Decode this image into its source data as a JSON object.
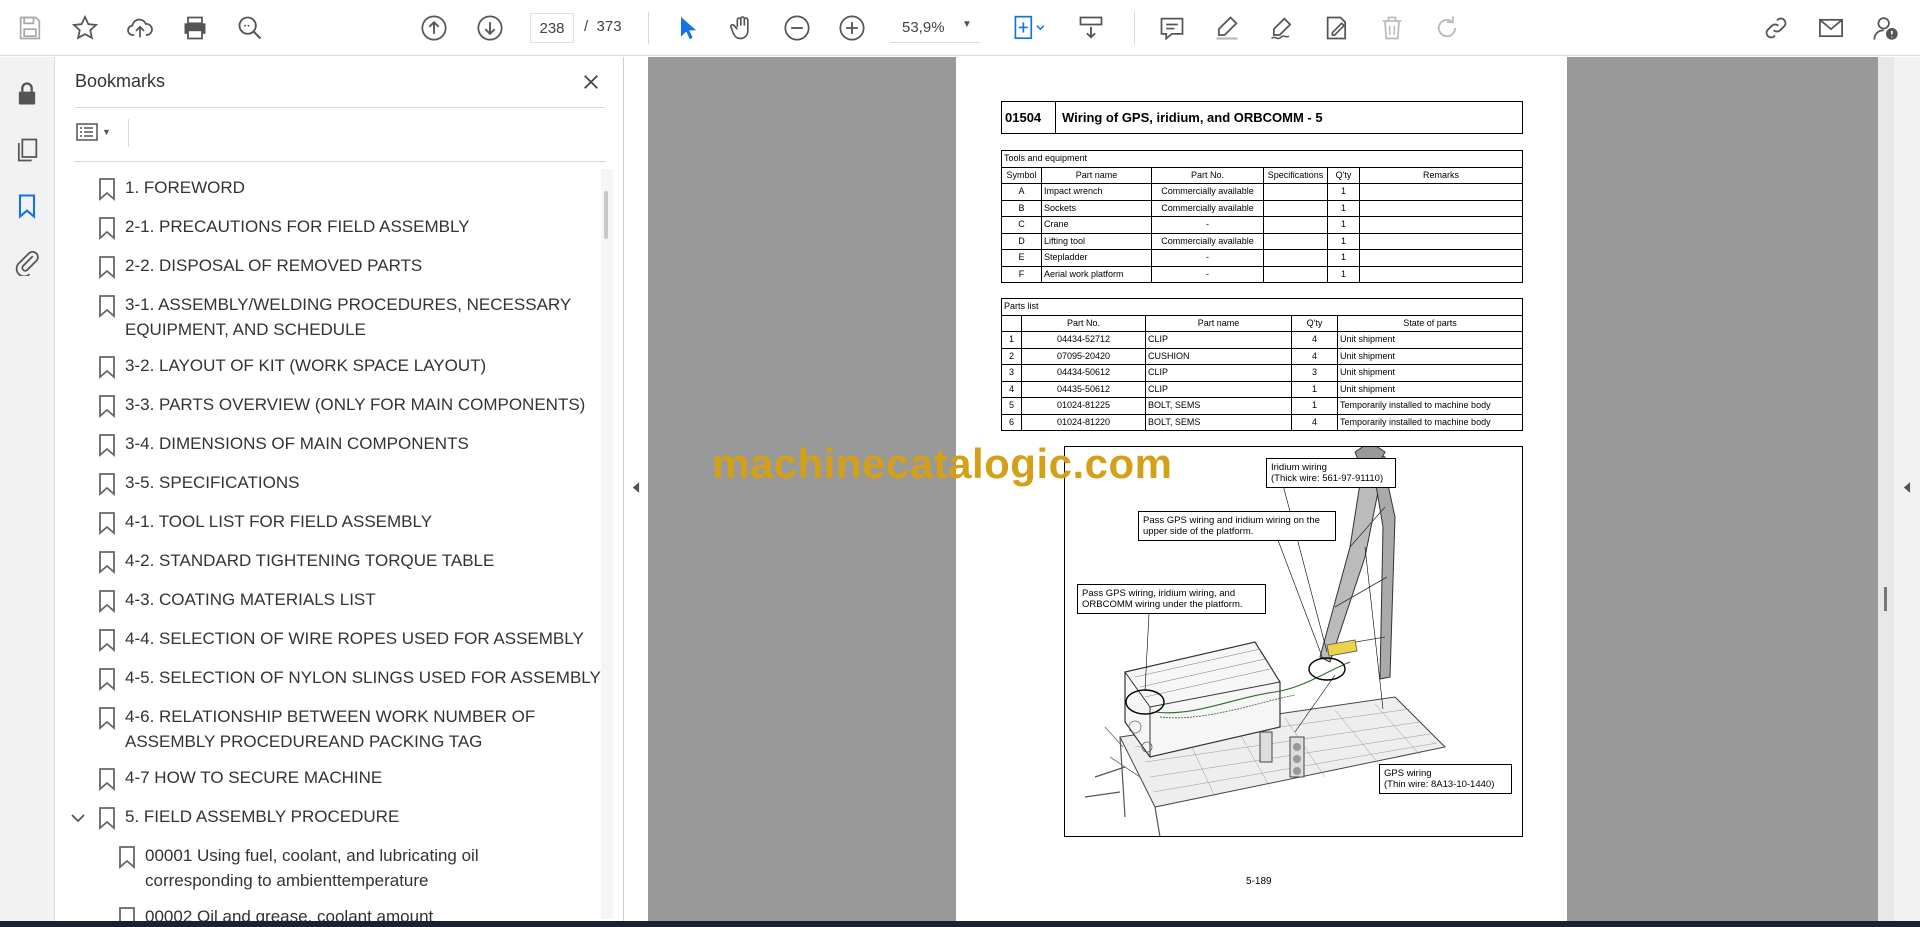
{
  "toolbar": {
    "page_current": "238",
    "page_total": "373",
    "page_separator": "/",
    "zoom": "53,9%"
  },
  "bookmarks": {
    "title": "Bookmarks",
    "items": [
      {
        "label": "1. FOREWORD"
      },
      {
        "label": "2-1. PRECAUTIONS FOR FIELD ASSEMBLY"
      },
      {
        "label": "2-2. DISPOSAL OF REMOVED PARTS"
      },
      {
        "label": "3-1. ASSEMBLY/WELDING PROCEDURES, NECESSARY",
        "label2": "EQUIPMENT, AND SCHEDULE"
      },
      {
        "label": "3-2. LAYOUT OF KIT (WORK SPACE LAYOUT)"
      },
      {
        "label": "3-3. PARTS OVERVIEW (ONLY FOR MAIN COMPONENTS)"
      },
      {
        "label": "3-4. DIMENSIONS OF MAIN COMPONENTS"
      },
      {
        "label": "3-5. SPECIFICATIONS"
      },
      {
        "label": "4-1. TOOL LIST FOR FIELD ASSEMBLY"
      },
      {
        "label": "4-2. STANDARD TIGHTENING TORQUE TABLE"
      },
      {
        "label": "4-3. COATING MATERIALS LIST"
      },
      {
        "label": "4-4. SELECTION OF WIRE ROPES USED FOR ASSEMBLY"
      },
      {
        "label": "4-5. SELECTION OF NYLON SLINGS USED FOR ASSEMBLY"
      },
      {
        "label": "4-6. RELATIONSHIP BETWEEN WORK NUMBER OF",
        "label2": "ASSEMBLY PROCEDUREAND PACKING TAG"
      },
      {
        "label": "4-7 HOW TO SECURE MACHINE"
      },
      {
        "label": "5. FIELD ASSEMBLY PROCEDURE"
      },
      {
        "label": "00001 Using fuel, coolant, and lubricating oil",
        "label2": "corresponding to ambienttemperature"
      },
      {
        "label": "00002 Oil and grease, coolant amount"
      }
    ]
  },
  "page": {
    "code": "01504",
    "title": "Wiring of GPS, iridium, and ORBCOMM - 5",
    "tools": {
      "caption": "Tools and equipment",
      "headers": [
        "Symbol",
        "Part name",
        "Part No.",
        "Specifications",
        "Q'ty",
        "Remarks"
      ],
      "rows": [
        [
          "A",
          "Impact wrench",
          "Commercially available",
          "",
          "1",
          ""
        ],
        [
          "B",
          "Sockets",
          "Commercially available",
          "",
          "1",
          ""
        ],
        [
          "C",
          "Crane",
          "-",
          "",
          "1",
          ""
        ],
        [
          "D",
          "Lifting tool",
          "Commercially available",
          "",
          "1",
          ""
        ],
        [
          "E",
          "Stepladder",
          "-",
          "",
          "1",
          ""
        ],
        [
          "F",
          "Aerial work platform",
          "-",
          "",
          "1",
          ""
        ]
      ]
    },
    "parts": {
      "caption": "Parts list",
      "headers": [
        "",
        "Part No.",
        "Part name",
        "Q'ty",
        "State of parts"
      ],
      "rows": [
        [
          "1",
          "04434-52712",
          "CLIP",
          "4",
          "Unit shipment"
        ],
        [
          "2",
          "07095-20420",
          "CUSHION",
          "4",
          "Unit shipment"
        ],
        [
          "3",
          "04434-50612",
          "CLIP",
          "3",
          "Unit shipment"
        ],
        [
          "4",
          "04435-50612",
          "CLIP",
          "1",
          "Unit shipment"
        ],
        [
          "5",
          "01024-81225",
          "BOLT, SEMS",
          "1",
          "Temporarily installed to machine body"
        ],
        [
          "6",
          "01024-81220",
          "BOLT, SEMS",
          "4",
          "Temporarily installed to machine body"
        ]
      ]
    },
    "callouts": {
      "iridium_1": "Iridium wiring",
      "iridium_2": "(Thick wire: 561-97-91110)",
      "upper_1": "Pass GPS wiring and iridium wiring on the",
      "upper_2": "upper side of the platform.",
      "under_1": "Pass GPS wiring, iridium wiring, and",
      "under_2": "ORBCOMM wiring under the platform.",
      "gps_1": "GPS wiring",
      "gps_2": "(Thin wire: 8A13-10-1440)"
    },
    "page_number": "5-189"
  },
  "watermark": "machinecatalogic.com"
}
